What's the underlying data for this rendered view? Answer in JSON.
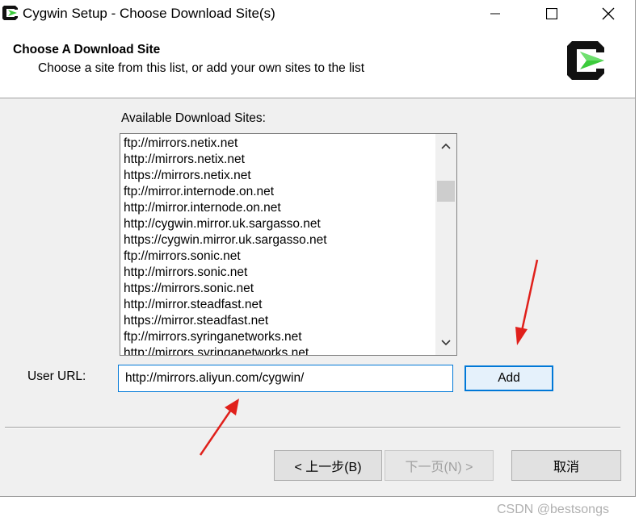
{
  "window": {
    "title": "Cygwin Setup - Choose Download Site(s)"
  },
  "header": {
    "title": "Choose A Download Site",
    "subtitle": "Choose a site from this list, or add your own sites to the list"
  },
  "sites": {
    "label": "Available Download Sites:",
    "items": [
      "ftp://mirrors.netix.net",
      "http://mirrors.netix.net",
      "https://mirrors.netix.net",
      "ftp://mirror.internode.on.net",
      "http://mirror.internode.on.net",
      "http://cygwin.mirror.uk.sargasso.net",
      "https://cygwin.mirror.uk.sargasso.net",
      "ftp://mirrors.sonic.net",
      "http://mirrors.sonic.net",
      "https://mirrors.sonic.net",
      "http://mirror.steadfast.net",
      "https://mirror.steadfast.net",
      "ftp://mirrors.syringanetworks.net",
      "http://mirrors.syringanetworks.net"
    ]
  },
  "user_url": {
    "label": "User URL:",
    "value": "http://mirrors.aliyun.com/cygwin/",
    "add_label": "Add"
  },
  "buttons": {
    "back": "< 上一步(B)",
    "next": "下一页(N) >",
    "cancel": "取消"
  },
  "watermark": "CSDN @bestsongs",
  "colors": {
    "accent": "#0078d7",
    "annotation_arrow": "#e0201b",
    "logo_green": "#3ccb3c"
  },
  "icons": {
    "app": "cygwin-logo-icon",
    "minimize": "minimize-icon",
    "maximize": "maximize-icon",
    "close": "close-icon",
    "scroll_up": "chevron-up-icon",
    "scroll_down": "chevron-down-icon"
  }
}
